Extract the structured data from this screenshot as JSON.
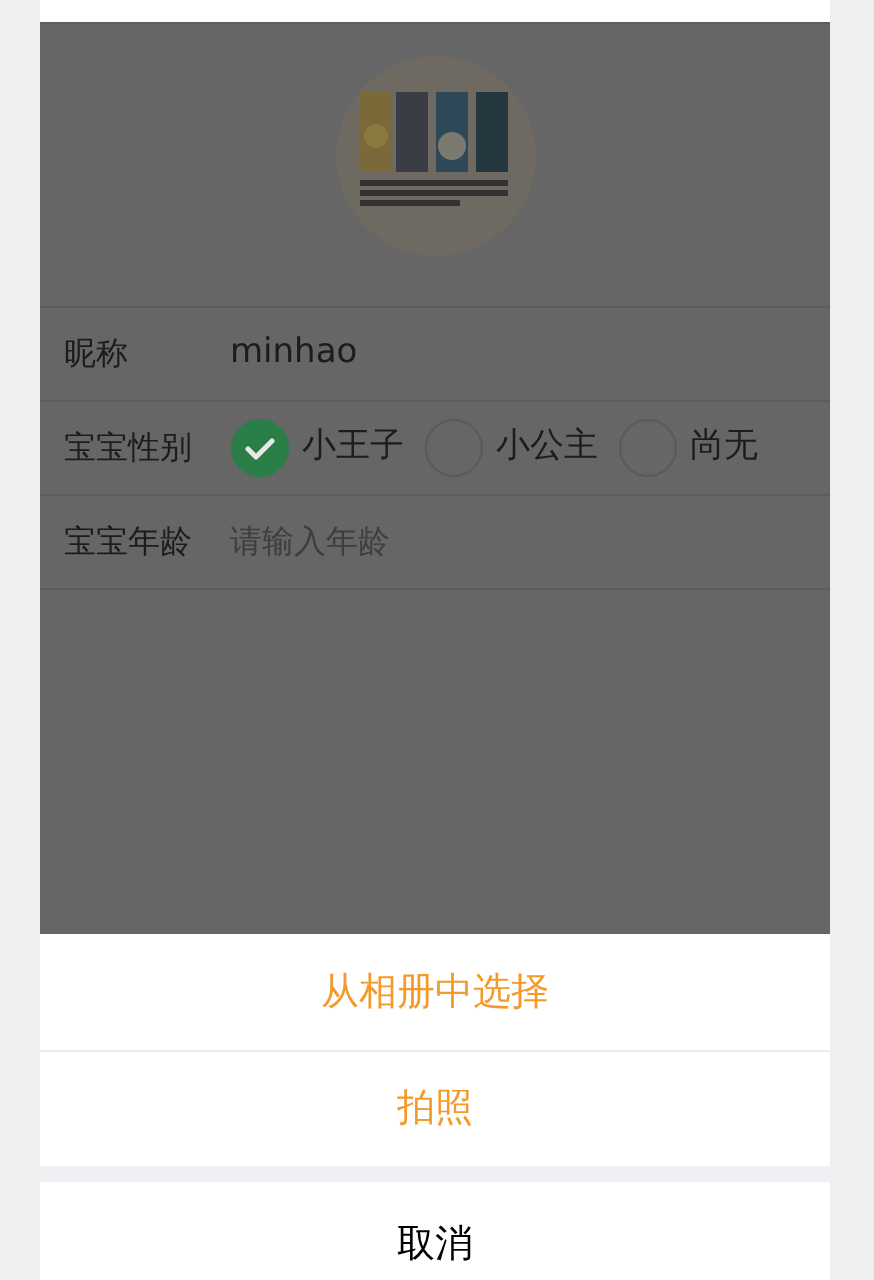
{
  "profile": {
    "nickname": {
      "label": "昵称",
      "value": "minhao"
    },
    "gender": {
      "label": "宝宝性别",
      "options": [
        {
          "label": "小王子",
          "selected": true
        },
        {
          "label": "小公主",
          "selected": false
        },
        {
          "label": "尚无",
          "selected": false
        }
      ]
    },
    "age": {
      "label": "宝宝年龄",
      "placeholder": "请输入年龄"
    }
  },
  "action_sheet": {
    "items": [
      {
        "label": "从相册中选择"
      },
      {
        "label": "拍照"
      }
    ],
    "cancel": "取消"
  }
}
